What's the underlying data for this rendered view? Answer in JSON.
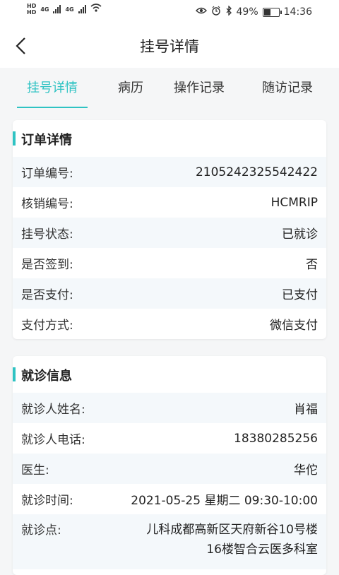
{
  "status_bar": {
    "net1": "HD",
    "net2": "HD",
    "g1": "4G",
    "g2": "4G",
    "battery": "49%",
    "time": "14:36",
    "battery_level": 0.49
  },
  "nav": {
    "title": "挂号详情"
  },
  "tabs": [
    {
      "label": "挂号详情",
      "active": true
    },
    {
      "label": "病历",
      "active": false
    },
    {
      "label": "操作记录",
      "active": false
    },
    {
      "label": "随访记录",
      "active": false
    }
  ],
  "order": {
    "title": "订单详情",
    "rows": [
      {
        "label": "订单编号:",
        "value": "2105242325542422"
      },
      {
        "label": "核销编号:",
        "value": "HCMRIP"
      },
      {
        "label": "挂号状态:",
        "value": "已就诊"
      },
      {
        "label": "是否签到:",
        "value": "否"
      },
      {
        "label": "是否支付:",
        "value": "已支付"
      },
      {
        "label": "支付方式:",
        "value": "微信支付"
      }
    ]
  },
  "visit": {
    "title": "就诊信息",
    "rows": [
      {
        "label": "就诊人姓名:",
        "value": "肖福"
      },
      {
        "label": "就诊人电话:",
        "value": "18380285256"
      },
      {
        "label": "医生:",
        "value": "华佗"
      },
      {
        "label": "就诊时间:",
        "value": "2021-05-25 星期二 09:30-10:00"
      },
      {
        "label": "就诊点:",
        "value_line1": "儿科成都高新区天府新谷10号楼",
        "value_line2": "16楼智合云医多科室"
      }
    ]
  },
  "colors": {
    "accent": "#2fc3c3",
    "row_alt": "#f4f8fb"
  }
}
